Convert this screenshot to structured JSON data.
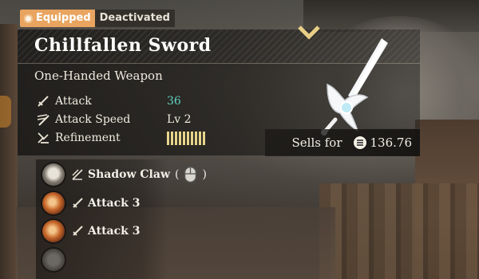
{
  "tabs": {
    "equipped": "Equipped",
    "deactivated": "Deactivated"
  },
  "item": {
    "name": "Chillfallen Sword",
    "type": "One-Handed Weapon",
    "icon": "sword-icon"
  },
  "stats": {
    "attack": {
      "label": "Attack",
      "value": "36",
      "icon": "sword-small-icon"
    },
    "speed": {
      "label": "Attack Speed",
      "value": "Lv 2",
      "icon": "speed-icon"
    },
    "refinement": {
      "label": "Refinement",
      "segments_filled": 10,
      "segments_total": 10,
      "icon": "refinement-icon"
    }
  },
  "sell": {
    "label": "Sells for",
    "value": "136.76",
    "icon": "coin-icon"
  },
  "skills": [
    {
      "name": "Shadow Claw",
      "open": "(",
      "close": ")",
      "icon": "claw-icon",
      "orb": "shadow-orb",
      "input": "mouse-icon"
    },
    {
      "name": "Attack 3",
      "icon": "sword-small-icon",
      "orb": "fire-orb"
    },
    {
      "name": "Attack 3",
      "icon": "sword-small-icon",
      "orb": "fire-orb"
    },
    {
      "name": "",
      "orb": "empty-orb"
    }
  ],
  "colors": {
    "equipped_tab": "#e9a560",
    "attack_value": "#5fd3c0",
    "refinement_bar": "#e7d58a"
  }
}
